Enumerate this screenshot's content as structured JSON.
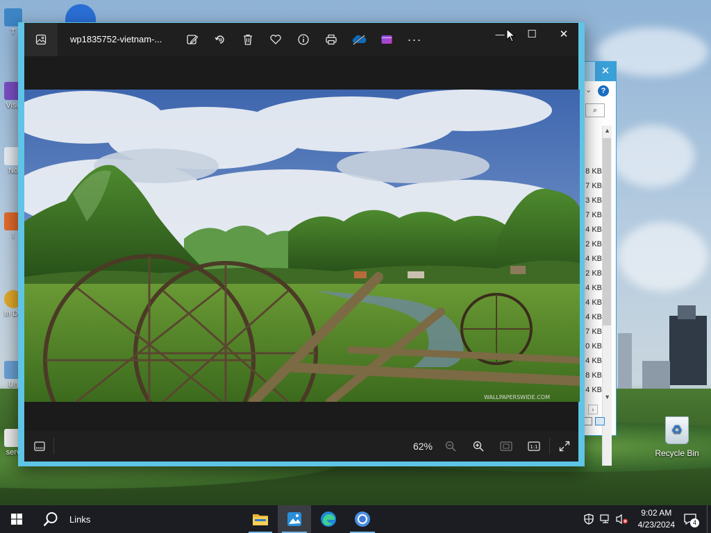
{
  "photos_window": {
    "title": "wp1835752-vietnam-...",
    "toolbar": {
      "items": [
        "edit-image",
        "rotate",
        "delete",
        "favorite",
        "file-info",
        "print",
        "onedrive",
        "clipchamp",
        "see-more"
      ]
    },
    "window_controls": {
      "minimize": "—",
      "maximize": "☐",
      "close": "✕"
    },
    "watermark": "WALLPAPERSWIDE.COM",
    "bottombar": {
      "zoom_label": "62%"
    }
  },
  "background_explorer": {
    "close": "✕",
    "help": "?",
    "search_glyph": "⌕",
    "sizes": [
      "8 KB",
      "7 KB",
      "3 KB",
      "7 KB",
      "4 KB",
      "2 KB",
      "4 KB",
      "2 KB",
      "4 KB",
      "4 KB",
      "4 KB",
      "7 KB",
      "0 KB",
      "4 KB",
      "8 KB",
      "4 KB"
    ]
  },
  "desktop": {
    "icon_labels": [
      "T",
      "Visu",
      "No",
      "I",
      "In Do",
      "Un",
      "serv"
    ],
    "recycle_bin_label": "Recycle Bin"
  },
  "taskbar": {
    "search_label": "Links",
    "time": "9:02 AM",
    "date": "4/23/2024",
    "notification_count": "4",
    "apps": [
      "file-explorer",
      "photos",
      "edge",
      "chrome"
    ]
  }
}
